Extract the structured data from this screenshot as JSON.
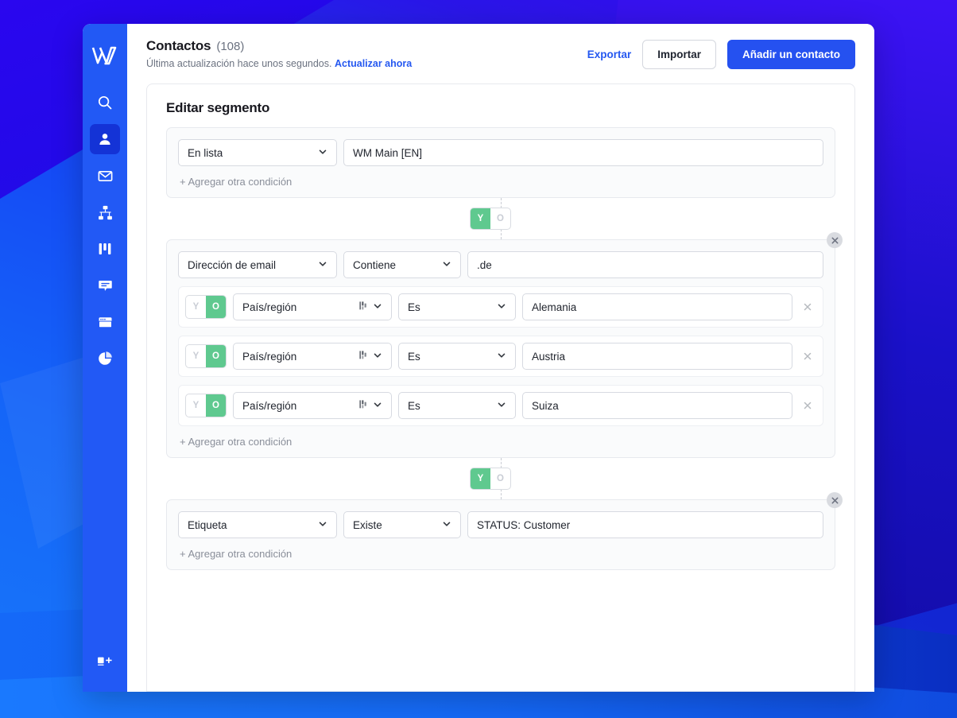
{
  "app": {
    "brand_color": "#2259f5",
    "accent_color": "#2551f0",
    "toggle_on_color": "#5fc98f"
  },
  "sidebar": {
    "logo_name": "wix-w-logo",
    "items": [
      {
        "name": "search-icon",
        "label": "Buscar"
      },
      {
        "name": "contacts-icon",
        "label": "Contactos",
        "active": true
      },
      {
        "name": "email-icon",
        "label": "Email marketing"
      },
      {
        "name": "automations-icon",
        "label": "Automatizaciones"
      },
      {
        "name": "kanban-icon",
        "label": "Tareas"
      },
      {
        "name": "chat-icon",
        "label": "Chat"
      },
      {
        "name": "forms-icon",
        "label": "Formularios"
      },
      {
        "name": "analytics-icon",
        "label": "Analítica"
      }
    ],
    "bottom_item": {
      "name": "add-app-icon",
      "label": "Agregar"
    }
  },
  "header": {
    "title": "Contactos",
    "count": "(108)",
    "subtitle_text": "Última actualización hace unos segundos.",
    "subtitle_link": "Actualizar ahora",
    "export_label": "Exportar",
    "import_label": "Importar",
    "add_contact_label": "Añadir un contacto"
  },
  "segment": {
    "title": "Editar segmento",
    "add_condition_label": "+ Agregar otra condición",
    "toggle": {
      "and_label": "Y",
      "or_label": "O"
    },
    "groups": [
      {
        "id": "group-1",
        "closable": false,
        "rows": [
          {
            "field": "En lista",
            "operator": null,
            "value": "WM Main [EN]",
            "has_flag_icon": false,
            "sub": false
          }
        ],
        "add_condition_label": "+ Agregar otra condición"
      },
      {
        "id": "group-2",
        "closable": true,
        "rows": [
          {
            "field": "Dirección de email",
            "operator": "Contiene",
            "value": ".de",
            "has_flag_icon": false,
            "sub": false
          },
          {
            "field": "País/región",
            "operator": "Es",
            "value": "Alemania",
            "has_flag_icon": true,
            "sub": true,
            "join": "O"
          },
          {
            "field": "País/región",
            "operator": "Es",
            "value": "Austria",
            "has_flag_icon": true,
            "sub": true,
            "join": "O"
          },
          {
            "field": "País/región",
            "operator": "Es",
            "value": "Suiza",
            "has_flag_icon": true,
            "sub": true,
            "join": "O"
          }
        ],
        "add_condition_label": "+ Agregar otra condición"
      },
      {
        "id": "group-3",
        "closable": true,
        "rows": [
          {
            "field": "Etiqueta",
            "operator": "Existe",
            "value": "STATUS: Customer",
            "has_flag_icon": false,
            "sub": false
          }
        ],
        "add_condition_label": "+ Agregar otra condición"
      }
    ],
    "connectors": [
      {
        "selected": "Y"
      },
      {
        "selected": "Y"
      }
    ]
  }
}
